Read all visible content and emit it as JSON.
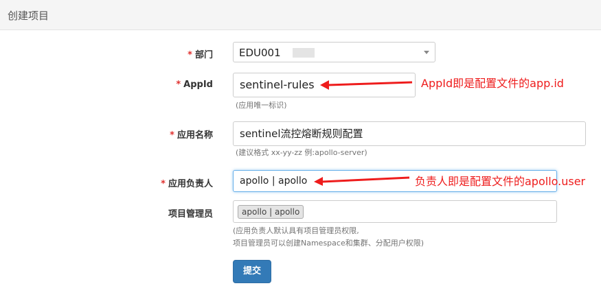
{
  "page": {
    "title": "创建项目"
  },
  "form": {
    "department": {
      "label": "部门",
      "required_mark": "*",
      "value": "EDU001"
    },
    "appid": {
      "label": "AppId",
      "required_mark": "*",
      "value": "sentinel-rules",
      "hint": "(应用唯一标识)"
    },
    "app_name": {
      "label": "应用名称",
      "required_mark": "*",
      "value": "sentinel流控熔断规则配置",
      "hint": "(建议格式 xx-yy-zz 例:apollo-server)"
    },
    "owner": {
      "label": "应用负责人",
      "required_mark": "*",
      "value": "apollo | apollo"
    },
    "admins": {
      "label": "项目管理员",
      "tag": "apollo | apollo",
      "hint_line1": "(应用负责人默认具有项目管理员权限,",
      "hint_line2": "项目管理员可以创建Namespace和集群、分配用户权限)"
    },
    "submit_label": "提交"
  },
  "annotations": {
    "appid_note": "AppId即是配置文件的app.id",
    "owner_note": "负责人即是配置文件的apollo.user",
    "color": "#ee1c1c"
  },
  "colors": {
    "primary": "#337ab7",
    "required": "#e0312f",
    "focus": "#66afe9"
  }
}
